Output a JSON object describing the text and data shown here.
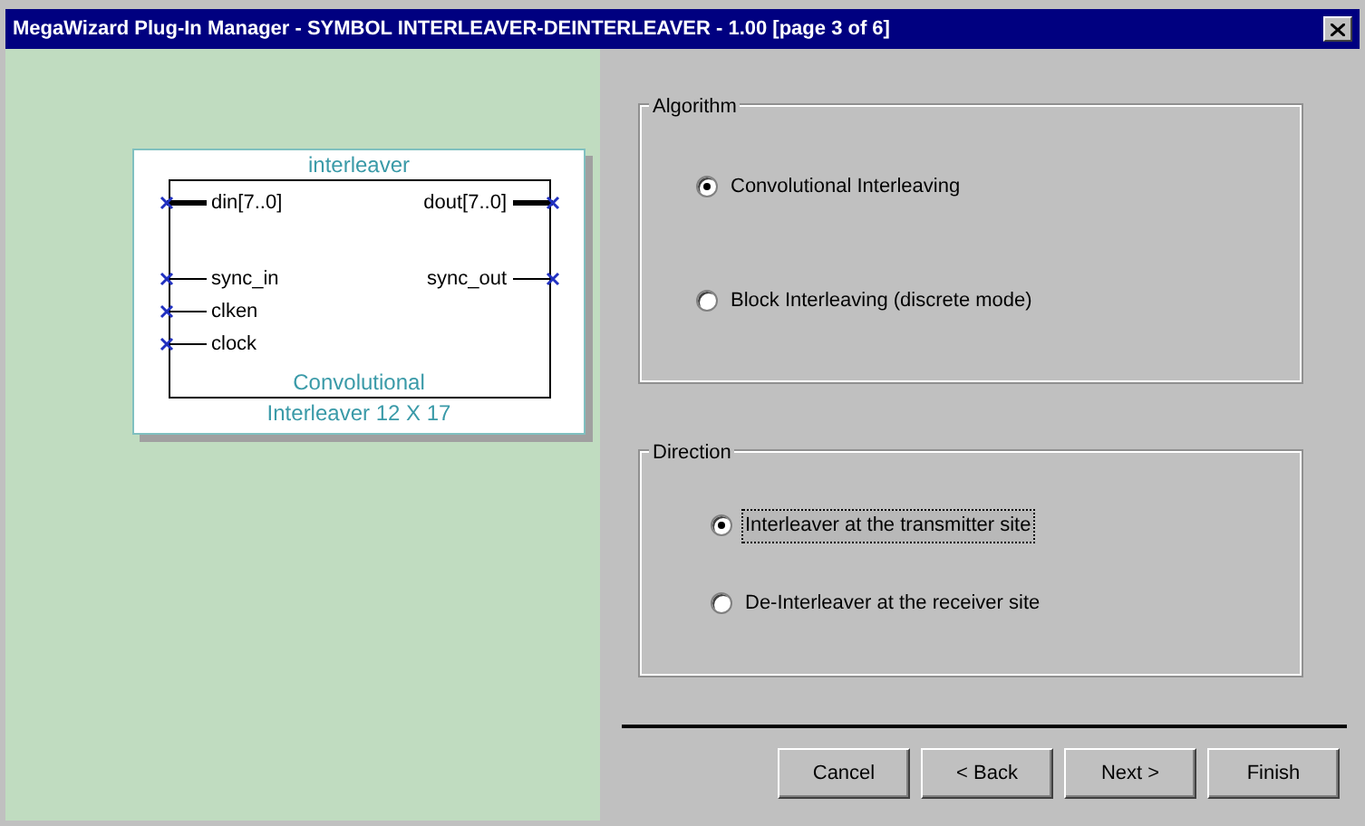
{
  "window": {
    "title": "MegaWizard Plug-In Manager - SYMBOL INTERLEAVER-DEINTERLEAVER - 1.00 [page 3 of 6]"
  },
  "symbol": {
    "title": "interleaver",
    "inputs": [
      {
        "name": "din[7..0]",
        "bus": true
      },
      {
        "name": "sync_in",
        "bus": false
      },
      {
        "name": "clken",
        "bus": false
      },
      {
        "name": "clock",
        "bus": false
      }
    ],
    "outputs": [
      {
        "name": "dout[7..0]",
        "bus": true
      },
      {
        "name": "sync_out",
        "bus": false
      }
    ],
    "footer": [
      "Convolutional",
      "Interleaver 12 X 17"
    ]
  },
  "groups": [
    {
      "title": "Algorithm",
      "options": [
        {
          "label": "Convolutional Interleaving",
          "selected": true,
          "focused": false
        },
        {
          "label": "Block Interleaving (discrete mode)",
          "selected": false,
          "focused": false
        }
      ]
    },
    {
      "title": "Direction",
      "options": [
        {
          "label": "Interleaver at the transmitter site",
          "selected": true,
          "focused": true
        },
        {
          "label": "De-Interleaver at the receiver site",
          "selected": false,
          "focused": false
        }
      ]
    }
  ],
  "buttons": [
    {
      "label": "Cancel"
    },
    {
      "label": "< Back"
    },
    {
      "label": "Next >"
    },
    {
      "label": "Finish"
    }
  ]
}
